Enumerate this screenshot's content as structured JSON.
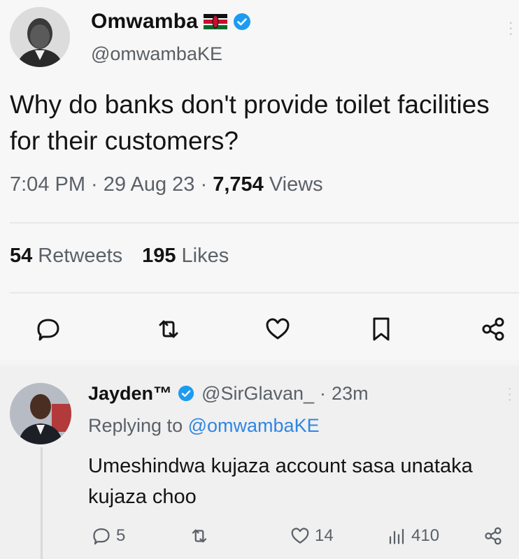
{
  "tweet": {
    "display_name": "Omwamba",
    "handle": "@omwambaKE",
    "text": "Why do banks don't provide toilet facilities for their customers?",
    "time": "7:04 PM",
    "date": "29 Aug 23",
    "views_count": "7,754",
    "views_label": "Views",
    "retweets_count": "54",
    "retweets_label": "Retweets",
    "likes_count": "195",
    "likes_label": "Likes"
  },
  "reply": {
    "display_name": "Jayden™",
    "handle": "@SirGlavan_",
    "time": "23m",
    "replying_prefix": "Replying to",
    "replying_to": "@omwambaKE",
    "text": "Umeshindwa kujaza account sasa unataka kujaza choo",
    "replies_count": "5",
    "likes_count": "14",
    "views_count": "410"
  },
  "icons": {
    "flag": "kenya-flag-icon",
    "verified": "verified-badge-icon",
    "reply": "comment-icon",
    "retweet": "retweet-icon",
    "like": "heart-icon",
    "bookmark": "bookmark-icon",
    "share": "share-icon",
    "views": "views-icon"
  },
  "colors": {
    "verified": "#1d9bf0",
    "mention": "#2f86e3",
    "muted": "#5b6168"
  }
}
